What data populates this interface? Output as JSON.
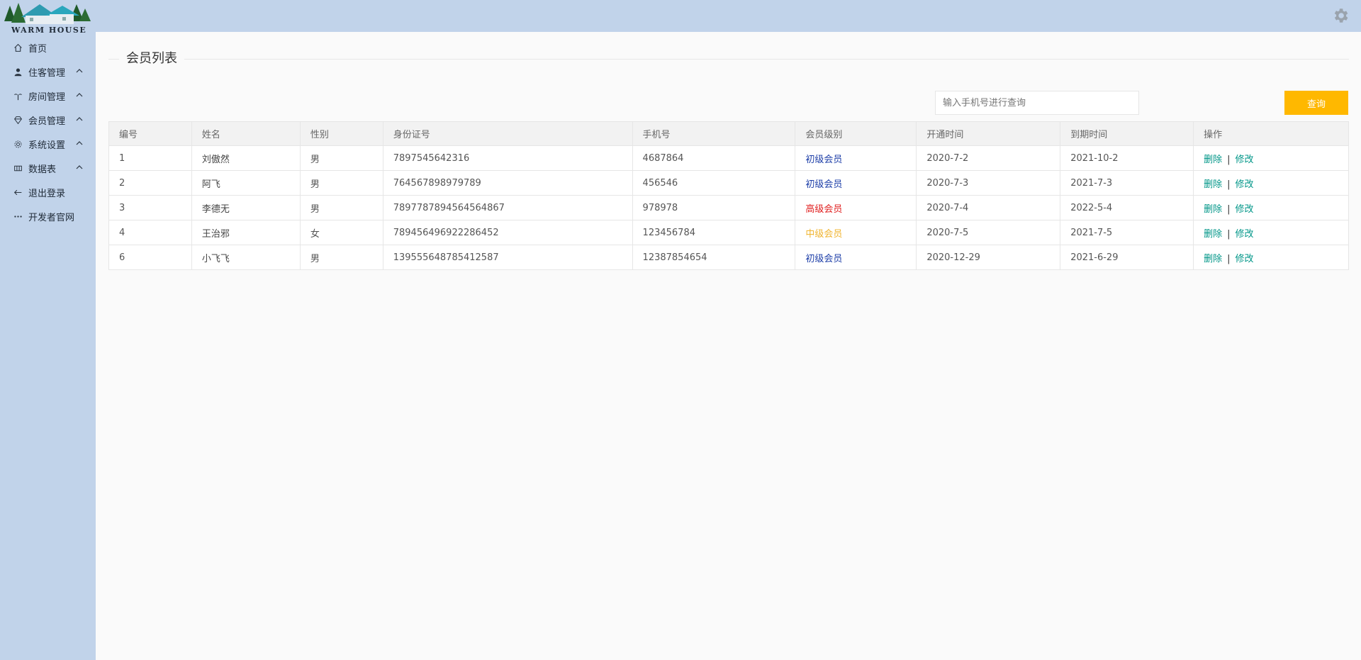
{
  "logo": {
    "text": "WARM HOUSE"
  },
  "sidebar": {
    "items": [
      {
        "label": "首页",
        "icon": "home-icon",
        "has_children": false
      },
      {
        "label": "住客管理",
        "icon": "user-icon",
        "has_children": true
      },
      {
        "label": "房间管理",
        "icon": "palm-tree-icon",
        "has_children": true
      },
      {
        "label": "会员管理",
        "icon": "diamond-icon",
        "has_children": true
      },
      {
        "label": "系统设置",
        "icon": "settings-icon",
        "has_children": true
      },
      {
        "label": "数据表",
        "icon": "table-icon",
        "has_children": true
      },
      {
        "label": "退出登录",
        "icon": "arrow-left-icon",
        "has_children": false
      },
      {
        "label": "开发者官网",
        "icon": "more-icon",
        "has_children": false
      }
    ]
  },
  "main": {
    "title": "会员列表",
    "search": {
      "placeholder": "输入手机号进行查询",
      "value": ""
    },
    "search_button": "查询"
  },
  "table": {
    "columns": [
      "编号",
      "姓名",
      "性别",
      "身份证号",
      "手机号",
      "会员级别",
      "开通时间",
      "到期时间",
      "操作"
    ],
    "rows": [
      {
        "id": "1",
        "name": "刘傲然",
        "gender": "男",
        "idcard": "7897545642316",
        "phone": "4687864",
        "level": "初级会员",
        "level_color": "#1e3fa8",
        "start": "2020-7-2",
        "end": "2021-10-2"
      },
      {
        "id": "2",
        "name": "阿飞",
        "gender": "男",
        "idcard": "764567898979789",
        "phone": "456546",
        "level": "初级会员",
        "level_color": "#1e3fa8",
        "start": "2020-7-3",
        "end": "2021-7-3"
      },
      {
        "id": "3",
        "name": "李德无",
        "gender": "男",
        "idcard": "7897787894564564867",
        "phone": "978978",
        "level": "高级会员",
        "level_color": "#e02020",
        "start": "2020-7-4",
        "end": "2022-5-4"
      },
      {
        "id": "4",
        "name": "王治邪",
        "gender": "女",
        "idcard": "789456496922286452",
        "phone": "123456784",
        "level": "中级会员",
        "level_color": "#f0b430",
        "start": "2020-7-5",
        "end": "2021-7-5"
      },
      {
        "id": "6",
        "name": "小飞飞",
        "gender": "男",
        "idcard": "139555648785412587",
        "phone": "12387854654",
        "level": "初级会员",
        "level_color": "#1e3fa8",
        "start": "2020-12-29",
        "end": "2021-6-29"
      }
    ],
    "actions": {
      "delete": "删除",
      "separator": "|",
      "edit": "修改"
    }
  },
  "colors": {
    "sidebar_bg": "#c1d3ea",
    "accent_button": "#ffb800",
    "action_link": "#009688"
  }
}
